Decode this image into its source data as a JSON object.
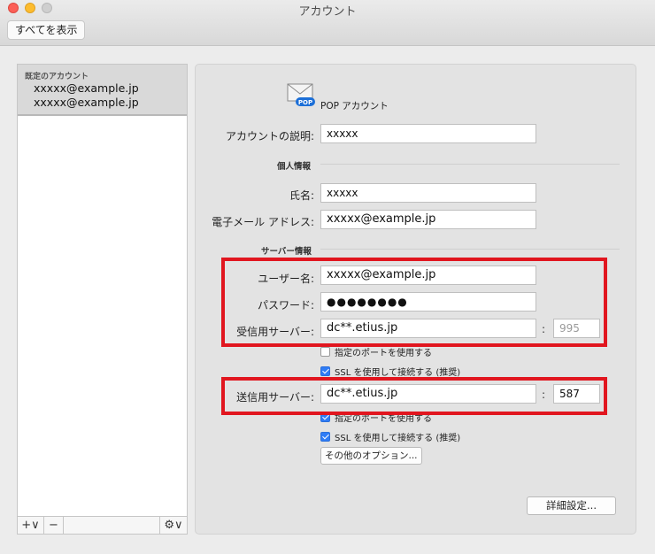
{
  "window": {
    "title": "アカウント",
    "show_all": "すべてを表示"
  },
  "sidebar": {
    "group_label": "既定のアカウント",
    "accounts": [
      "xxxxx@example.jp",
      "xxxxx@example.jp"
    ],
    "add_label": "+∨",
    "remove_label": "−",
    "gear_label": "⚙∨"
  },
  "account": {
    "type_label": "POP アカウント",
    "icon_badge": "POP",
    "description_label": "アカウントの説明:",
    "description_value": "xxxxx",
    "personal_section": "個人情報",
    "name_label": "氏名:",
    "name_value": "xxxxx",
    "email_label": "電子メール アドレス:",
    "email_value": "xxxxx@example.jp",
    "server_section": "サーバー情報",
    "username_label": "ユーザー名:",
    "username_value": "xxxxx@example.jp",
    "password_label": "パスワード:",
    "password_value": "●●●●●●●●",
    "incoming_label": "受信用サーバー:",
    "incoming_value": "dc**.etius.jp",
    "incoming_port": "995",
    "incoming_custom_port_label": "指定のポートを使用する",
    "incoming_custom_port_checked": false,
    "incoming_ssl_label": "SSL を使用して接続する (推奨)",
    "incoming_ssl_checked": true,
    "outgoing_label": "送信用サーバー:",
    "outgoing_value": "dc**.etius.jp",
    "outgoing_port": "587",
    "outgoing_custom_port_label": "指定のポートを使用する",
    "outgoing_custom_port_checked": true,
    "outgoing_ssl_label": "SSL を使用して接続する (推奨)",
    "outgoing_ssl_checked": true,
    "more_options_label": "その他のオプション...",
    "advanced_label": "詳細設定...",
    "colon": ":"
  },
  "colors": {
    "highlight": "#e1161f",
    "checkbox": "#2f7cf6"
  }
}
